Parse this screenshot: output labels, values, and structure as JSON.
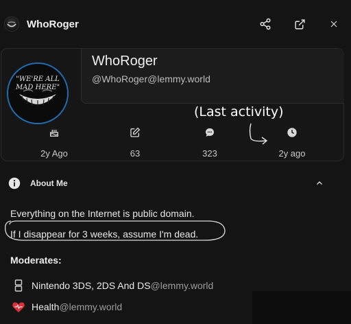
{
  "header": {
    "title": "WhoRoger",
    "avatar_caption": "We're All Mad Here"
  },
  "profile": {
    "display_name": "WhoRoger",
    "handle": "@WhoRoger@lemmy.world"
  },
  "stats": [
    {
      "icon": "cake-icon",
      "value": "2y Ago"
    },
    {
      "icon": "post-edit-icon",
      "value": "63"
    },
    {
      "icon": "comment-icon",
      "value": "323"
    },
    {
      "icon": "clock-icon",
      "value": "2y ago"
    }
  ],
  "annotation": {
    "text": "(Last activity)"
  },
  "about": {
    "title": "About Me",
    "bio_line_1": "Everything on the Internet is public domain.",
    "bio_line_2": "If I disappear for 3 weeks, assume I'm dead."
  },
  "moderates": {
    "title": "Moderates:",
    "items": [
      {
        "icon": "gamepad-icon",
        "name": "Nintendo 3DS, 2DS And DS",
        "domain": "@lemmy.world"
      },
      {
        "icon": "heart-icon",
        "name": "Health",
        "domain": "@lemmy.world"
      }
    ]
  },
  "colors": {
    "background": "#141414",
    "avatar_ring": "#1e6fb3",
    "heart": "#d9303b"
  }
}
